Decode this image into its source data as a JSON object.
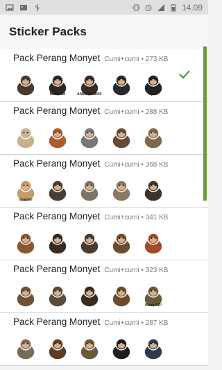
{
  "statusbar": {
    "time": "14.09",
    "icons": [
      "image-notification-icon",
      "photo-notification-icon",
      "usb-icon",
      "vibrate-icon",
      "alarm-icon",
      "signal-icon",
      "battery-icon"
    ]
  },
  "app": {
    "title": "Sticker Packs"
  },
  "packs": [
    {
      "name": "Pack Perang Monyet",
      "meta": "Cumi+cumi • 273 KB",
      "selected": true,
      "captions": [
        "",
        "MAS SIDI",
        "AAN PROMKIK",
        "",
        "nya..."
      ]
    },
    {
      "name": "Pack Perang Monyet",
      "meta": "Cumi+cumi • 288 KB",
      "selected": false,
      "captions": [
        "",
        "",
        "",
        "",
        ""
      ]
    },
    {
      "name": "Pack Perang Monyet",
      "meta": "Cumi+cumi • 368 KB",
      "selected": false,
      "captions": [
        "ngapain",
        "",
        "",
        "",
        ""
      ]
    },
    {
      "name": "Pack Perang Monyet",
      "meta": "Cumi+cumi • 341 KB",
      "selected": false,
      "captions": [
        "",
        "",
        "",
        "",
        ""
      ]
    },
    {
      "name": "Pack Perang Monyet",
      "meta": "Cumi+cumi • 323 KB",
      "selected": false,
      "captions": [
        "",
        "",
        "",
        "",
        "Woah OR!"
      ]
    },
    {
      "name": "Pack Perang Monyet",
      "meta": "Cumi+cumi • 287 KB",
      "selected": false,
      "captions": [
        "",
        "",
        "",
        "",
        ""
      ]
    }
  ],
  "colors": {
    "accent": "#689f38",
    "check": "#3c8a3f"
  }
}
